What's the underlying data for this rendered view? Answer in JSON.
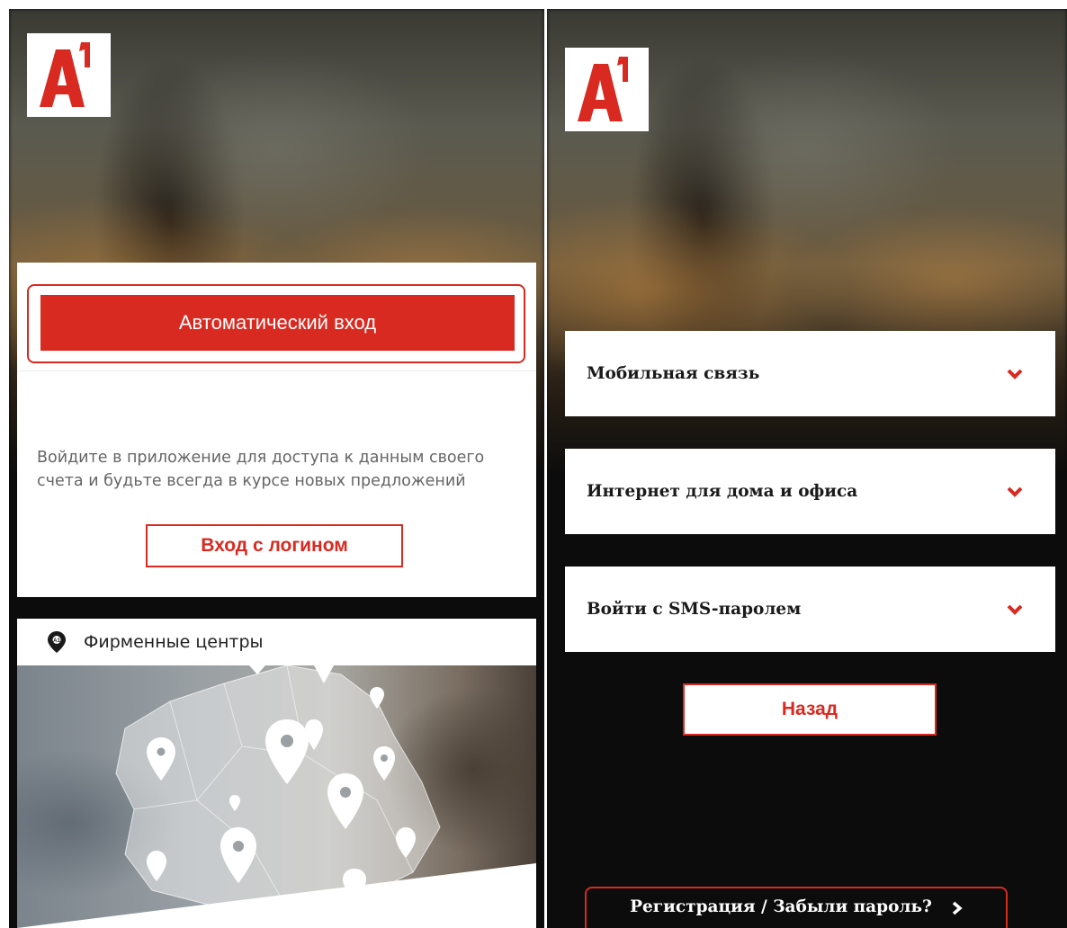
{
  "left_screen": {
    "logo": {
      "text": "A1",
      "icon": "a1-logo-icon"
    },
    "login": {
      "auto_login_label": "Автоматический вход",
      "description": "Войдите в приложение для доступа к данным своего счета и будьте всегда в курсе новых предложений",
      "login_button_label": "Вход с логином"
    },
    "centers": {
      "title": "Фирменные центры",
      "icon": "location-pin-icon"
    }
  },
  "right_screen": {
    "logo": {
      "text": "A1",
      "icon": "a1-logo-icon"
    },
    "accordion": [
      {
        "label": "Мобильная связь",
        "icon": "chevron-down-icon"
      },
      {
        "label": "Интернет для дома и офиса",
        "icon": "chevron-down-icon"
      },
      {
        "label": "Войти с SMS-паролем",
        "icon": "chevron-down-icon"
      }
    ],
    "back_label": "Назад",
    "register_label": "Регистрация / Забыли пароль?",
    "register_icon": "chevron-right-icon"
  },
  "colors": {
    "accent": "#d82a20",
    "background_dark": "#0c0c0c",
    "card": "#ffffff"
  }
}
